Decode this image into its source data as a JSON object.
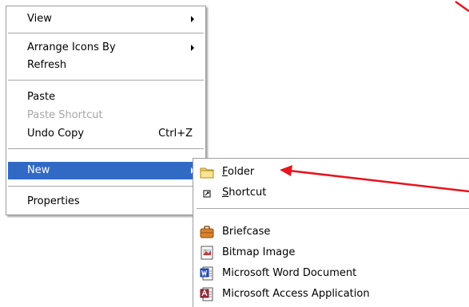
{
  "context_menu": {
    "items": [
      {
        "label": "View"
      },
      {
        "label": "Arrange Icons By"
      },
      {
        "label": "Refresh"
      },
      {
        "label": "Paste"
      },
      {
        "label": "Paste Shortcut"
      },
      {
        "label": "Undo Copy",
        "shortcut": "Ctrl+Z"
      },
      {
        "label": "New"
      },
      {
        "label": "Properties"
      }
    ]
  },
  "new_submenu": {
    "items": [
      {
        "label": "Folder",
        "mnemonic": "F",
        "rest": "older",
        "icon": "folder-icon"
      },
      {
        "label": "Shortcut",
        "mnemonic": "S",
        "rest": "hortcut",
        "icon": "shortcut-icon"
      },
      {
        "label": "Briefcase",
        "icon": "briefcase-icon"
      },
      {
        "label": "Bitmap Image",
        "icon": "bitmap-image-icon"
      },
      {
        "label": "Microsoft Word Document",
        "icon": "word-document-icon"
      },
      {
        "label": "Microsoft Access Application",
        "icon": "access-application-icon"
      }
    ]
  },
  "colors": {
    "highlight": "#316ac5",
    "annotation_arrow": "#e8141e",
    "disabled_text": "#a6a6a6"
  }
}
